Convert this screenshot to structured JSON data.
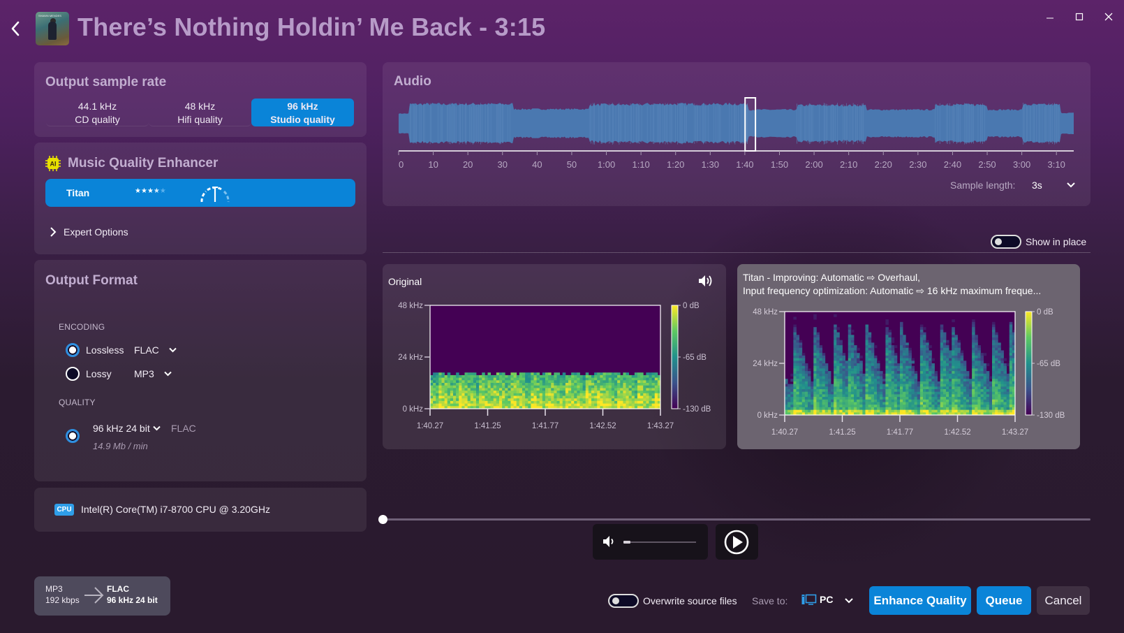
{
  "window": {
    "title": "There’s Nothing Holdin’ Me Back - 3:15",
    "controls": [
      "minimize",
      "maximize",
      "close"
    ]
  },
  "album_art": {
    "alt": "Shawn Mendes Illuminate album cover"
  },
  "sample_rate": {
    "title": "Output sample rate",
    "options": [
      {
        "rate": "44.1 kHz",
        "label": "CD quality",
        "selected": false
      },
      {
        "rate": "48 kHz",
        "label": "Hifi quality",
        "selected": false
      },
      {
        "rate": "96 kHz",
        "label": "Studio quality",
        "selected": true
      }
    ]
  },
  "enhancer": {
    "title": "Music Quality Enhancer",
    "badge": "AI",
    "model": {
      "name": "Titan",
      "rating": 3.5,
      "rating_max": 5,
      "speed_level": "medium"
    },
    "expert_options_label": "Expert Options"
  },
  "output_format": {
    "title": "Output Format",
    "encoding_label": "ENCODING",
    "encodings": [
      {
        "label": "Lossless",
        "codec": "FLAC",
        "selected": true
      },
      {
        "label": "Lossy",
        "codec": "MP3",
        "selected": false
      }
    ],
    "quality_label": "QUALITY",
    "quality": {
      "value": "96 kHz 24 bit",
      "codec": "FLAC",
      "size": "14.9 Mb / min",
      "selected": true
    }
  },
  "cpu": {
    "badge": "CPU",
    "name": "Intel(R) Core(TM) i7-8700 CPU @ 3.20GHz"
  },
  "conversion": {
    "from_format": "MP3",
    "from_detail": "192 kbps",
    "to_format": "FLAC",
    "to_detail": "96 kHz 24 bit"
  },
  "audio": {
    "title": "Audio",
    "duration_seconds": 195,
    "selection_start_seconds": 100.27,
    "selection_length_seconds": 3,
    "timeline_ticks": [
      "0",
      "10",
      "20",
      "30",
      "40",
      "50",
      "1:00",
      "1:10",
      "1:20",
      "1:30",
      "1:40",
      "1:50",
      "2:00",
      "2:10",
      "2:20",
      "2:30",
      "2:40",
      "2:50",
      "3:00",
      "3:10"
    ],
    "sample_length_label": "Sample length:",
    "sample_length_value": "3s",
    "waveform_color": "#4a78b0"
  },
  "show_in_place": {
    "label": "Show in place",
    "on": false
  },
  "spectrogram_original": {
    "title": "Original",
    "y_ticks": [
      "48 kHz",
      "24 kHz",
      "0 kHz"
    ],
    "x_ticks": [
      "1:40.27",
      "1:41.25",
      "1:41.77",
      "1:42.52",
      "1:43.27"
    ],
    "colorbar_ticks": [
      "0 dB",
      "-65 dB",
      "-130 dB"
    ],
    "cutoff_khz": 16
  },
  "spectrogram_enhanced": {
    "title_line1": "Titan - Improving: Automatic ⇨ Overhaul,",
    "title_line2": "Input frequency optimization: Automatic ⇨ 16 kHz maximum freque...",
    "y_ticks": [
      "48 kHz",
      "24 kHz",
      "0 kHz"
    ],
    "x_ticks": [
      "1:40.27",
      "1:41.25",
      "1:41.77",
      "1:42.52",
      "1:43.27"
    ],
    "colorbar_ticks": [
      "0 dB",
      "-65 dB",
      "-130 dB"
    ]
  },
  "player": {
    "position": 0,
    "volume": 0.1
  },
  "footer": {
    "overwrite_label": "Overwrite source files",
    "overwrite_on": false,
    "save_to_label": "Save to:",
    "save_target": "PC",
    "enhance_label": "Enhance Quality",
    "queue_label": "Queue",
    "cancel_label": "Cancel"
  },
  "colors": {
    "accent": "#0a84d8",
    "title": "#b79bc8",
    "ai_badge": "#e8e000"
  }
}
